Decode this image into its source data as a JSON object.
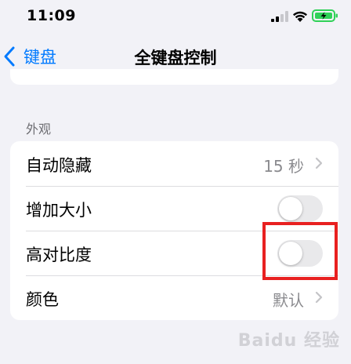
{
  "status_bar": {
    "time": "11:09",
    "signal_icon": "cellular-signal-icon",
    "wifi_icon": "wifi-icon",
    "battery_icon": "battery-charging-icon",
    "battery_color": "#30d158"
  },
  "nav": {
    "back_label": "键盘",
    "title": "全键盘控制",
    "accent": "#007aff"
  },
  "section": {
    "header": "外观",
    "rows": [
      {
        "label": "自动隐藏",
        "value": "15 秒",
        "type": "disclosure"
      },
      {
        "label": "增加大小",
        "type": "toggle",
        "on": false
      },
      {
        "label": "高对比度",
        "type": "toggle",
        "on": false
      },
      {
        "label": "颜色",
        "value": "默认",
        "type": "disclosure"
      }
    ]
  },
  "watermark": "Baidu 经验"
}
